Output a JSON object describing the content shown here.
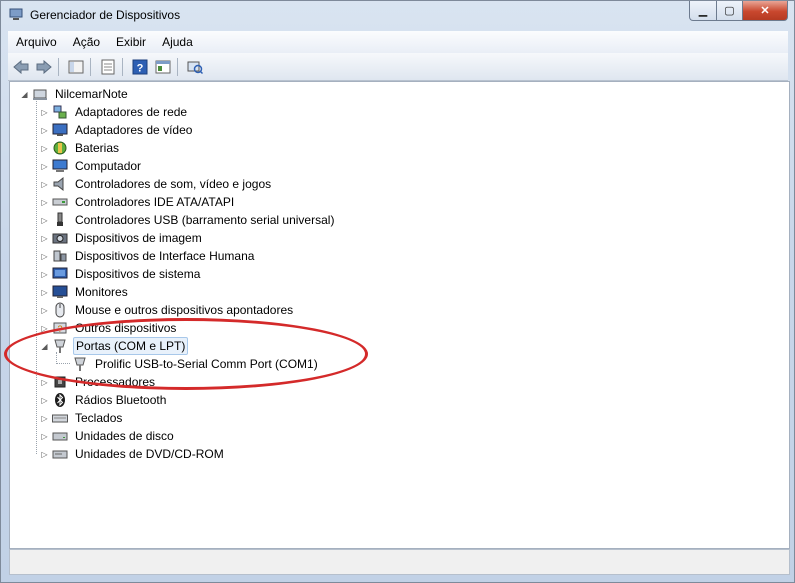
{
  "window": {
    "title": "Gerenciador de Dispositivos"
  },
  "menu": [
    "Arquivo",
    "Ação",
    "Exibir",
    "Ajuda"
  ],
  "toolbar": [
    "back-icon",
    "forward-icon",
    "up-folder-icon",
    "properties-icon",
    "help-icon",
    "view-icon",
    "scan-hardware-icon"
  ],
  "tree": {
    "root": "NilcemarNote",
    "items": [
      {
        "label": "Adaptadores de rede",
        "icon": "network-adapter-icon"
      },
      {
        "label": "Adaptadores de vídeo",
        "icon": "display-adapter-icon"
      },
      {
        "label": "Baterias",
        "icon": "battery-icon"
      },
      {
        "label": "Computador",
        "icon": "computer-icon"
      },
      {
        "label": "Controladores de som, vídeo e jogos",
        "icon": "speaker-icon"
      },
      {
        "label": "Controladores IDE ATA/ATAPI",
        "icon": "ide-controller-icon"
      },
      {
        "label": "Controladores USB (barramento serial universal)",
        "icon": "usb-icon"
      },
      {
        "label": "Dispositivos de imagem",
        "icon": "camera-icon"
      },
      {
        "label": "Dispositivos de Interface Humana",
        "icon": "hid-icon"
      },
      {
        "label": "Dispositivos de sistema",
        "icon": "system-device-icon"
      },
      {
        "label": "Monitores",
        "icon": "monitor-icon"
      },
      {
        "label": "Mouse e outros dispositivos apontadores",
        "icon": "mouse-icon"
      },
      {
        "label": "Outros dispositivos",
        "icon": "unknown-device-icon"
      },
      {
        "label": "Portas (COM e LPT)",
        "icon": "port-icon",
        "expanded": true,
        "selected": true,
        "children": [
          {
            "label": "Prolific USB-to-Serial Comm Port (COM1)",
            "icon": "port-icon"
          }
        ]
      },
      {
        "label": "Processadores",
        "icon": "processor-icon"
      },
      {
        "label": "Rádios Bluetooth",
        "icon": "bluetooth-icon"
      },
      {
        "label": "Teclados",
        "icon": "keyboard-icon"
      },
      {
        "label": "Unidades de disco",
        "icon": "disk-drive-icon"
      },
      {
        "label": "Unidades de DVD/CD-ROM",
        "icon": "dvd-drive-icon"
      }
    ]
  },
  "colors": {
    "annotation": "#d42a2a",
    "selection": "#e8f1fb"
  }
}
